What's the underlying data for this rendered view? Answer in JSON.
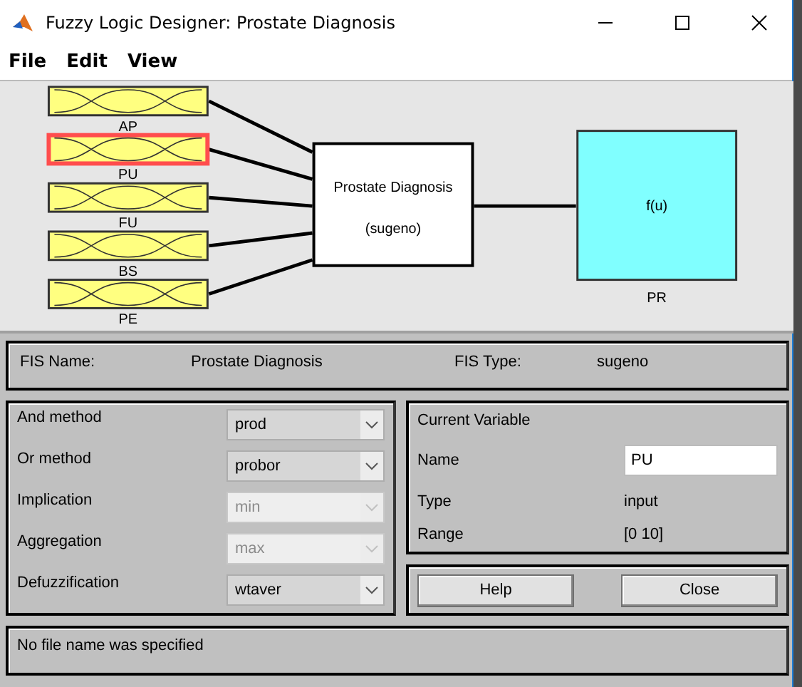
{
  "window": {
    "title": "Fuzzy Logic Designer: Prostate Diagnosis"
  },
  "menu": [
    "File",
    "Edit",
    "View"
  ],
  "diagram": {
    "inputs": [
      {
        "name": "AP",
        "selected": false
      },
      {
        "name": "PU",
        "selected": true
      },
      {
        "name": "FU",
        "selected": false
      },
      {
        "name": "BS",
        "selected": false
      },
      {
        "name": "PE",
        "selected": false
      }
    ],
    "system": {
      "name": "Prostate Diagnosis",
      "type": "(sugeno)"
    },
    "output": {
      "function": "f(u)",
      "name": "PR"
    }
  },
  "fis": {
    "name_label": "FIS Name:",
    "name": "Prostate Diagnosis",
    "type_label": "FIS Type:",
    "type": "sugeno"
  },
  "methods": [
    {
      "label": "And method",
      "value": "prod",
      "disabled": false
    },
    {
      "label": "Or method",
      "value": "probor",
      "disabled": false
    },
    {
      "label": "Implication",
      "value": "min",
      "disabled": true
    },
    {
      "label": "Aggregation",
      "value": "max",
      "disabled": true
    },
    {
      "label": "Defuzzification",
      "value": "wtaver",
      "disabled": false
    }
  ],
  "current_variable": {
    "title": "Current Variable",
    "name_label": "Name",
    "name": "PU",
    "type_label": "Type",
    "type": "input",
    "range_label": "Range",
    "range": "[0 10]"
  },
  "buttons": [
    "Help",
    "Close"
  ],
  "status_bar": "No file name was specified"
}
